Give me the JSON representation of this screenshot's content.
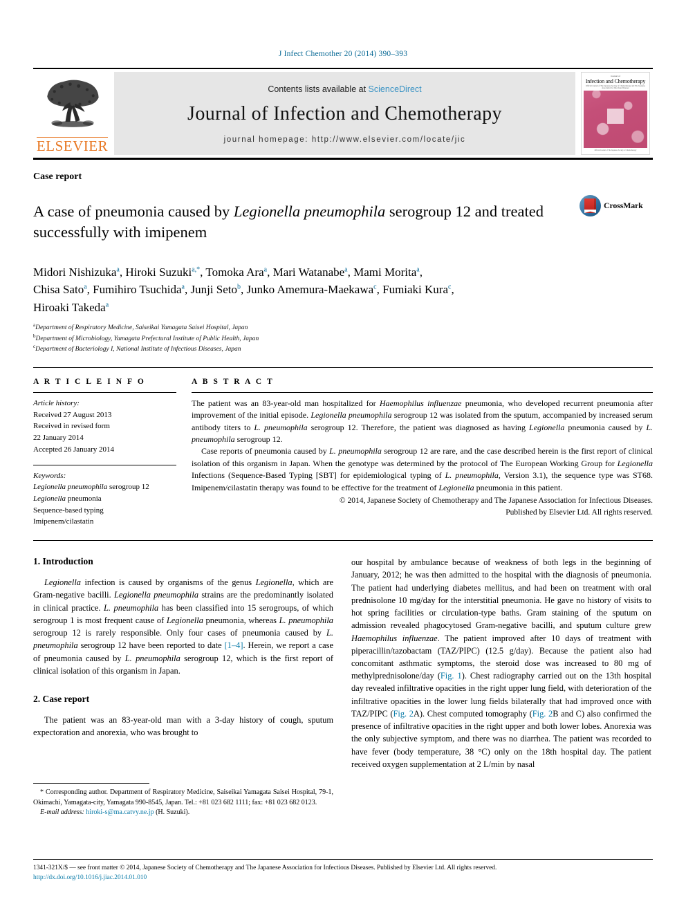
{
  "running_head": "J Infect Chemother 20 (2014) 390–393",
  "masthead": {
    "publisher_name": "ELSEVIER",
    "contents_prefix": "Contents lists available at",
    "contents_link": "ScienceDirect",
    "journal_title": "Journal of Infection and Chemotherapy",
    "homepage_label": "journal homepage: http://www.elsevier.com/locate/jic",
    "cover": {
      "line1": "Journal of",
      "line2": "Infection and Chemotherapy",
      "line3": "Official Journal of The Japanese Society of Chemotherapy and The Japanese Association for Infectious Diseases",
      "footer": "Official Journal of The Japanese Society of Chemotherapy"
    }
  },
  "article": {
    "type": "Case report",
    "title_part1": "A case of pneumonia caused by ",
    "title_italic1": "Legionella pneumophila",
    "title_part2": " serogroup 12 and treated successfully with imipenem",
    "crossmark_label": "CrossMark"
  },
  "authors": [
    {
      "name": "Midori Nishizuka",
      "sup": "a",
      "sep": ", "
    },
    {
      "name": "Hiroki Suzuki",
      "sup": "a,*",
      "sep": ", "
    },
    {
      "name": "Tomoka Ara",
      "sup": "a",
      "sep": ", "
    },
    {
      "name": "Mari Watanabe",
      "sup": "a",
      "sep": ", "
    },
    {
      "name": "Mami Morita",
      "sup": "a",
      "sep": ", "
    },
    {
      "name": "Chisa Sato",
      "sup": "a",
      "sep": ", "
    },
    {
      "name": "Fumihiro Tsuchida",
      "sup": "a",
      "sep": ", "
    },
    {
      "name": "Junji Seto",
      "sup": "b",
      "sep": ", "
    },
    {
      "name": "Junko Amemura-Maekawa",
      "sup": "c",
      "sep": ", "
    },
    {
      "name": "Fumiaki Kura",
      "sup": "c",
      "sep": ", "
    },
    {
      "name": "Hiroaki Takeda",
      "sup": "a",
      "sep": ""
    }
  ],
  "affiliations": [
    {
      "sup": "a",
      "text": "Department of Respiratory Medicine, Saiseikai Yamagata Saisei Hospital, Japan"
    },
    {
      "sup": "b",
      "text": "Department of Microbiology, Yamagata Prefectural Institute of Public Health, Japan"
    },
    {
      "sup": "c",
      "text": "Department of Bacteriology I, National Institute of Infectious Diseases, Japan"
    }
  ],
  "article_info": {
    "heading": "A R T I C L E   I N F O",
    "history_label": "Article history:",
    "history": [
      "Received 27 August 2013",
      "Received in revised form",
      "22 January 2014",
      "Accepted 26 January 2014"
    ],
    "keywords_label": "Keywords:",
    "keywords": [
      "Legionella pneumophila serogroup 12",
      "Legionella pneumonia",
      "Sequence-based typing",
      "Imipenem/cilastatin"
    ]
  },
  "abstract": {
    "heading": "A B S T R A C T",
    "paragraph1": "The patient was an 83-year-old man hospitalized for Haemophilus influenzae pneumonia, who developed recurrent pneumonia after improvement of the initial episode. Legionella pneumophila serogroup 12 was isolated from the sputum, accompanied by increased serum antibody titers to L. pneumophila serogroup 12. Therefore, the patient was diagnosed as having Legionella pneumonia caused by L. pneumophila serogroup 12.",
    "paragraph2": "Case reports of pneumonia caused by L. pneumophila serogroup 12 are rare, and the case described herein is the first report of clinical isolation of this organism in Japan. When the genotype was determined by the protocol of The European Working Group for Legionella Infections (Sequence-Based Typing [SBT] for epidemiological typing of L. pneumophila, Version 3.1), the sequence type was ST68. Imipenem/cilastatin therapy was found to be effective for the treatment of Legionella pneumonia in this patient.",
    "copyright_line1": "© 2014, Japanese Society of Chemotherapy and The Japanese Association for Infectious Diseases.",
    "copyright_line2": "Published by Elsevier Ltd. All rights reserved."
  },
  "sections": {
    "intro_heading": "1. Introduction",
    "intro_paragraph": "Legionella infection is caused by organisms of the genus Legionella, which are Gram-negative bacilli. Legionella pneumophila strains are the predominantly isolated in clinical practice. L. pneumophila has been classified into 15 serogroups, of which serogroup 1 is most frequent cause of Legionella pneumonia, whereas L. pneumophila serogroup 12 is rarely responsible. Only four cases of pneumonia caused by L. pneumophila serogroup 12 have been reported to date [1–4]. Herein, we report a case of pneumonia caused by L. pneumophila serogroup 12, which is the first report of clinical isolation of this organism in Japan.",
    "intro_citation": "[1–4]",
    "case_heading": "2. Case report",
    "case_paragraph_left": "The patient was an 83-year-old man with a 3-day history of cough, sputum expectoration and anorexia, who was brought to",
    "case_paragraph_right": "our hospital by ambulance because of weakness of both legs in the beginning of January, 2012; he was then admitted to the hospital with the diagnosis of pneumonia. The patient had underlying diabetes mellitus, and had been on treatment with oral prednisolone 10 mg/day for the interstitial pneumonia. He gave no history of visits to hot spring facilities or circulation-type baths. Gram staining of the sputum on admission revealed phagocytosed Gram-negative bacilli, and sputum culture grew Haemophilus influenzae. The patient improved after 10 days of treatment with piperacillin/tazobactam (TAZ/PIPC) (12.5 g/day). Because the patient also had concomitant asthmatic symptoms, the steroid dose was increased to 80 mg of methylprednisolone/day (Fig. 1). Chest radiography carried out on the 13th hospital day revealed infiltrative opacities in the right upper lung field, with deterioration of the infiltrative opacities in the lower lung fields bilaterally that had improved once with TAZ/PIPC (Fig. 2A). Chest computed tomography (Fig. 2B and C) also confirmed the presence of infiltrative opacities in the right upper and both lower lobes. Anorexia was the only subjective symptom, and there was no diarrhea. The patient was recorded to have fever (body temperature, 38 °C) only on the 18th hospital day. The patient received oxygen supplementation at 2 L/min by nasal"
  },
  "footnote": {
    "corresponding": "* Corresponding author. Department of Respiratory Medicine, Saiseikai Yamagata Saisei Hospital, 79-1, Okimachi, Yamagata-city, Yamagata 990-8545, Japan. Tel.: +81 023 682 1111; fax: +81 023 682 0123.",
    "email_label": "E-mail address:",
    "email": "hiroki-s@ma.catvy.ne.jp",
    "email_owner": "(H. Suzuki)."
  },
  "footer": {
    "issn_line": "1341-321X/$ — see front matter © 2014, Japanese Society of Chemotherapy and The Japanese Association for Infectious Diseases. Published by Elsevier Ltd. All rights reserved.",
    "doi": "http://dx.doi.org/10.1016/j.jiac.2014.01.010"
  },
  "colors": {
    "link": "#0a7ba8",
    "sciencedirect": "#3a93c4",
    "elsevier_orange": "#E87722",
    "cover_pink": "#c44f78"
  }
}
